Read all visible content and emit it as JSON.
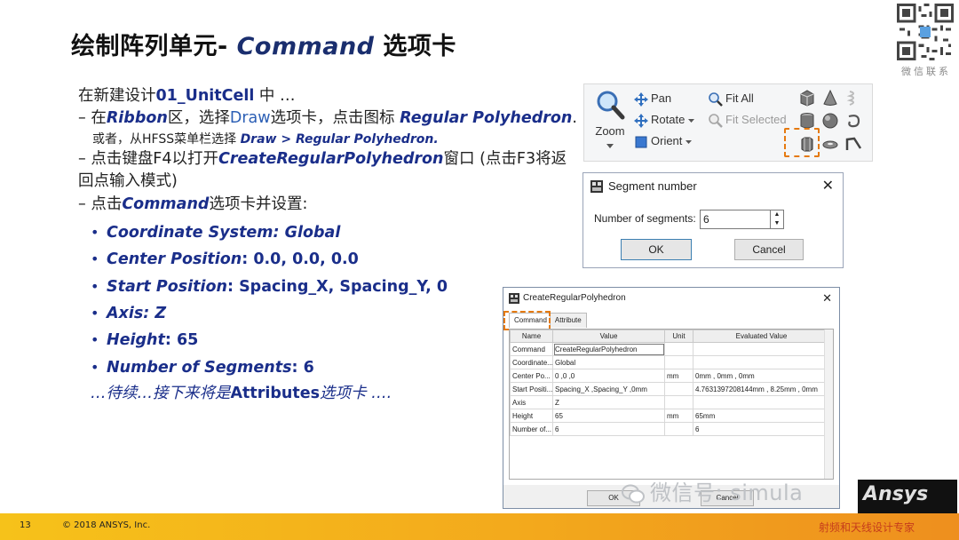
{
  "slide": {
    "title_prefix": "绘制阵列单元- ",
    "title_command": "Command",
    "title_suffix": " 选项卡"
  },
  "qr": {
    "caption": "微信联系"
  },
  "body": {
    "l1_a": "在新建设计",
    "l1_b": "01_UnitCell",
    "l1_c": " 中 …",
    "l2_a": "– 在",
    "l2_b": "Ribbon",
    "l2_c": "区，选择",
    "l2_d": "Draw",
    "l2_e": "选项卡，点击图标 ",
    "l2_f": "Regular Polyhedron",
    "l2_g": ".",
    "l3_a": "或者，从HFSS菜单栏选择 ",
    "l3_b": "Draw > Regular Polyhedron.",
    "l4_a": "– 点击键盘F4以打开",
    "l4_b": "CreateRegularPolyhedron",
    "l4_c": "窗口 (点击F3将返回点输入模式)",
    "l5_a": "– 点击",
    "l5_b": "Command",
    "l5_c": "选项卡并设置:",
    "bullets": [
      {
        "label": "Coordinate System: Global",
        "value": ""
      },
      {
        "label": "Center Position",
        "value": ": 0.0, 0.0, 0.0"
      },
      {
        "label": "Start Position",
        "value": ": Spacing_X, Spacing_Y, 0"
      },
      {
        "label": "Axis: Z",
        "value": ""
      },
      {
        "label": "Height",
        "value": ": 65"
      },
      {
        "label": "Number of Segments",
        "value": ": 6"
      }
    ],
    "cont_a": "…待续…接下来将是",
    "cont_b": "Attributes",
    "cont_c": "选项卡 …."
  },
  "ribbon": {
    "zoom": "Zoom",
    "pan": "Pan",
    "rotate": "Rotate",
    "orient": "Orient",
    "fit_all": "Fit All",
    "fit_selected": "Fit Selected"
  },
  "segment_dialog": {
    "title": "Segment number",
    "label": "Number of segments:",
    "value": "6",
    "ok": "OK",
    "cancel": "Cancel"
  },
  "crp_dialog": {
    "title": "CreateRegularPolyhedron",
    "tabs": [
      "Command",
      "Attribute"
    ],
    "columns": [
      "Name",
      "Value",
      "Unit",
      "Evaluated Value"
    ],
    "rows": [
      [
        "Command",
        "CreateRegularPolyhedron",
        "",
        ""
      ],
      [
        "Coordinate...",
        "Global",
        "",
        ""
      ],
      [
        "Center Po...",
        "0 ,0 ,0",
        "mm",
        "0mm , 0mm , 0mm"
      ],
      [
        "Start Positi...",
        "Spacing_X ,Spacing_Y ,0mm",
        "",
        "4.7631397208144mm , 8.25mm , 0mm"
      ],
      [
        "Axis",
        "Z",
        "",
        ""
      ],
      [
        "Height",
        "65",
        "mm",
        "65mm"
      ],
      [
        "Number of...",
        "6",
        "",
        "6"
      ]
    ],
    "ok": "OK",
    "cancel": "Cancel"
  },
  "watermark": {
    "text": "微信号: simula",
    "brand": "Ansys"
  },
  "footer": {
    "page": "13",
    "copyright": "© 2018 ANSYS, Inc.",
    "cn_brand": "射频和天线设计专家"
  }
}
